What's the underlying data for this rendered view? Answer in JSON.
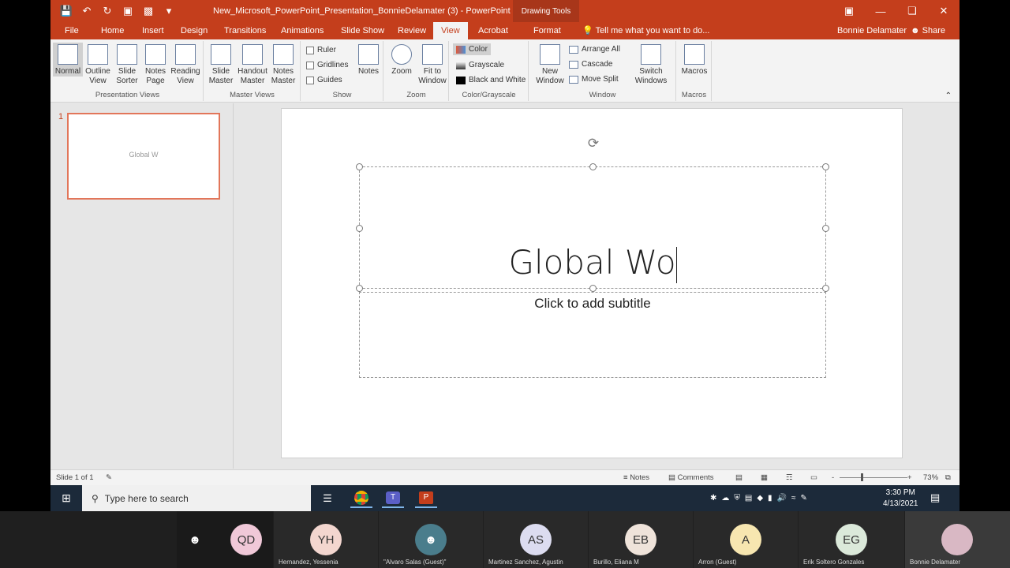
{
  "titlebar": {
    "doc_title": "New_Microsoft_PowerPoint_Presentation_BonnieDelamater (3) - PowerPoint",
    "context_tab_group": "Drawing Tools"
  },
  "tabs": [
    "File",
    "Home",
    "Insert",
    "Design",
    "Transitions",
    "Animations",
    "Slide Show",
    "Review",
    "View",
    "Acrobat",
    "Format"
  ],
  "active_tab": "View",
  "tell_me": "Tell me what you want to do...",
  "user_name": "Bonnie Delamater",
  "share_label": "Share",
  "ribbon": {
    "presentation_views": {
      "label": "Presentation Views",
      "normal": "Normal",
      "outline_view": "Outline View",
      "slide_sorter": "Slide Sorter",
      "notes_page": "Notes Page",
      "reading_view": "Reading View"
    },
    "master_views": {
      "label": "Master Views",
      "slide_master": "Slide Master",
      "handout_master": "Handout Master",
      "notes_master": "Notes Master"
    },
    "show": {
      "label": "Show",
      "ruler": "Ruler",
      "gridlines": "Gridlines",
      "guides": "Guides",
      "notes": "Notes"
    },
    "zoom": {
      "label": "Zoom",
      "zoom": "Zoom",
      "fit_to_window": "Fit to Window"
    },
    "color_grayscale": {
      "label": "Color/Grayscale",
      "color": "Color",
      "grayscale": "Grayscale",
      "black_and_white": "Black and White"
    },
    "window": {
      "label": "Window",
      "new_window": "New Window",
      "arrange_all": "Arrange All",
      "cascade": "Cascade",
      "move_split": "Move Split",
      "switch_windows": "Switch Windows"
    },
    "macros": {
      "label": "Macros",
      "macros": "Macros"
    }
  },
  "thumbnails": [
    {
      "number": "1",
      "text": "Global W"
    }
  ],
  "slide": {
    "title_text": "Global Wo",
    "subtitle_placeholder": "Click to add subtitle"
  },
  "statusbar": {
    "slide_info": "Slide 1 of 1",
    "notes": "Notes",
    "comments": "Comments",
    "zoom_level": "73%",
    "zoom_minus": "-",
    "zoom_plus": "+"
  },
  "taskbar": {
    "search_placeholder": "Type here to search",
    "time": "3:30 PM",
    "date": "4/13/2021"
  },
  "participants": [
    {
      "initials": "",
      "name": "",
      "color": "#4a7d8c"
    },
    {
      "initials": "QD",
      "name": "",
      "color": "#f0c8d8"
    },
    {
      "initials": "YH",
      "name": "Hernandez, Yessenia",
      "color": "#f3d6cf"
    },
    {
      "initials": "",
      "name": "\"Alvaro Salas (Guest)\"",
      "color": "#4a7d8c"
    },
    {
      "initials": "AS",
      "name": "Martinez Sanchez, Agustin",
      "color": "#dcdcf0"
    },
    {
      "initials": "EB",
      "name": "Burillo, Eliana M",
      "color": "#efe3da"
    },
    {
      "initials": "A",
      "name": "Arron (Guest)",
      "color": "#f7e6b0"
    },
    {
      "initials": "EG",
      "name": "Erik Soltero Gonzales",
      "color": "#dbe9da"
    },
    {
      "initials": "",
      "name": "Bonnie Delamater",
      "color": "#d9b8c4"
    }
  ]
}
